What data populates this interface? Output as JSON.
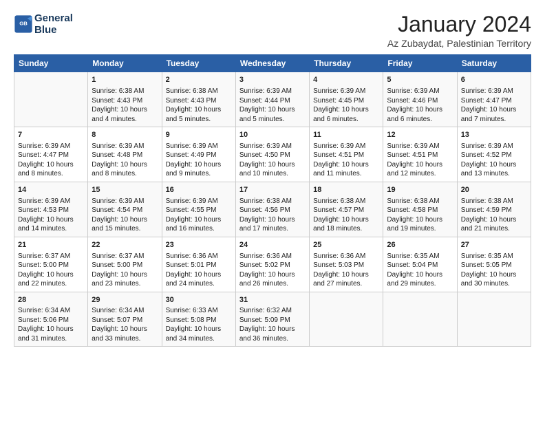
{
  "logo": {
    "line1": "General",
    "line2": "Blue"
  },
  "title": "January 2024",
  "subtitle": "Az Zubaydat, Palestinian Territory",
  "header": {
    "days": [
      "Sunday",
      "Monday",
      "Tuesday",
      "Wednesday",
      "Thursday",
      "Friday",
      "Saturday"
    ]
  },
  "weeks": [
    [
      {
        "num": "",
        "detail": ""
      },
      {
        "num": "1",
        "detail": "Sunrise: 6:38 AM\nSunset: 4:43 PM\nDaylight: 10 hours\nand 4 minutes."
      },
      {
        "num": "2",
        "detail": "Sunrise: 6:38 AM\nSunset: 4:43 PM\nDaylight: 10 hours\nand 5 minutes."
      },
      {
        "num": "3",
        "detail": "Sunrise: 6:39 AM\nSunset: 4:44 PM\nDaylight: 10 hours\nand 5 minutes."
      },
      {
        "num": "4",
        "detail": "Sunrise: 6:39 AM\nSunset: 4:45 PM\nDaylight: 10 hours\nand 6 minutes."
      },
      {
        "num": "5",
        "detail": "Sunrise: 6:39 AM\nSunset: 4:46 PM\nDaylight: 10 hours\nand 6 minutes."
      },
      {
        "num": "6",
        "detail": "Sunrise: 6:39 AM\nSunset: 4:47 PM\nDaylight: 10 hours\nand 7 minutes."
      }
    ],
    [
      {
        "num": "7",
        "detail": "Sunrise: 6:39 AM\nSunset: 4:47 PM\nDaylight: 10 hours\nand 8 minutes."
      },
      {
        "num": "8",
        "detail": "Sunrise: 6:39 AM\nSunset: 4:48 PM\nDaylight: 10 hours\nand 8 minutes."
      },
      {
        "num": "9",
        "detail": "Sunrise: 6:39 AM\nSunset: 4:49 PM\nDaylight: 10 hours\nand 9 minutes."
      },
      {
        "num": "10",
        "detail": "Sunrise: 6:39 AM\nSunset: 4:50 PM\nDaylight: 10 hours\nand 10 minutes."
      },
      {
        "num": "11",
        "detail": "Sunrise: 6:39 AM\nSunset: 4:51 PM\nDaylight: 10 hours\nand 11 minutes."
      },
      {
        "num": "12",
        "detail": "Sunrise: 6:39 AM\nSunset: 4:51 PM\nDaylight: 10 hours\nand 12 minutes."
      },
      {
        "num": "13",
        "detail": "Sunrise: 6:39 AM\nSunset: 4:52 PM\nDaylight: 10 hours\nand 13 minutes."
      }
    ],
    [
      {
        "num": "14",
        "detail": "Sunrise: 6:39 AM\nSunset: 4:53 PM\nDaylight: 10 hours\nand 14 minutes."
      },
      {
        "num": "15",
        "detail": "Sunrise: 6:39 AM\nSunset: 4:54 PM\nDaylight: 10 hours\nand 15 minutes."
      },
      {
        "num": "16",
        "detail": "Sunrise: 6:39 AM\nSunset: 4:55 PM\nDaylight: 10 hours\nand 16 minutes."
      },
      {
        "num": "17",
        "detail": "Sunrise: 6:38 AM\nSunset: 4:56 PM\nDaylight: 10 hours\nand 17 minutes."
      },
      {
        "num": "18",
        "detail": "Sunrise: 6:38 AM\nSunset: 4:57 PM\nDaylight: 10 hours\nand 18 minutes."
      },
      {
        "num": "19",
        "detail": "Sunrise: 6:38 AM\nSunset: 4:58 PM\nDaylight: 10 hours\nand 19 minutes."
      },
      {
        "num": "20",
        "detail": "Sunrise: 6:38 AM\nSunset: 4:59 PM\nDaylight: 10 hours\nand 21 minutes."
      }
    ],
    [
      {
        "num": "21",
        "detail": "Sunrise: 6:37 AM\nSunset: 5:00 PM\nDaylight: 10 hours\nand 22 minutes."
      },
      {
        "num": "22",
        "detail": "Sunrise: 6:37 AM\nSunset: 5:00 PM\nDaylight: 10 hours\nand 23 minutes."
      },
      {
        "num": "23",
        "detail": "Sunrise: 6:36 AM\nSunset: 5:01 PM\nDaylight: 10 hours\nand 24 minutes."
      },
      {
        "num": "24",
        "detail": "Sunrise: 6:36 AM\nSunset: 5:02 PM\nDaylight: 10 hours\nand 26 minutes."
      },
      {
        "num": "25",
        "detail": "Sunrise: 6:36 AM\nSunset: 5:03 PM\nDaylight: 10 hours\nand 27 minutes."
      },
      {
        "num": "26",
        "detail": "Sunrise: 6:35 AM\nSunset: 5:04 PM\nDaylight: 10 hours\nand 29 minutes."
      },
      {
        "num": "27",
        "detail": "Sunrise: 6:35 AM\nSunset: 5:05 PM\nDaylight: 10 hours\nand 30 minutes."
      }
    ],
    [
      {
        "num": "28",
        "detail": "Sunrise: 6:34 AM\nSunset: 5:06 PM\nDaylight: 10 hours\nand 31 minutes."
      },
      {
        "num": "29",
        "detail": "Sunrise: 6:34 AM\nSunset: 5:07 PM\nDaylight: 10 hours\nand 33 minutes."
      },
      {
        "num": "30",
        "detail": "Sunrise: 6:33 AM\nSunset: 5:08 PM\nDaylight: 10 hours\nand 34 minutes."
      },
      {
        "num": "31",
        "detail": "Sunrise: 6:32 AM\nSunset: 5:09 PM\nDaylight: 10 hours\nand 36 minutes."
      },
      {
        "num": "",
        "detail": ""
      },
      {
        "num": "",
        "detail": ""
      },
      {
        "num": "",
        "detail": ""
      }
    ]
  ]
}
